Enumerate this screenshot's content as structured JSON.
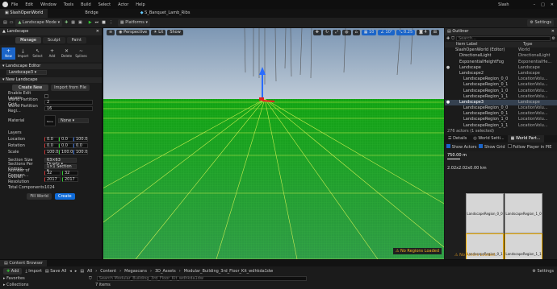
{
  "titlebar": {
    "project": "SlashOpenWorld",
    "menu": [
      "File",
      "Edit",
      "Window",
      "Tools",
      "Build",
      "Select",
      "Actor",
      "Help"
    ],
    "user": "Slash"
  },
  "tabs": [
    "Landscape Mode",
    "Bridge",
    "S_Banquet_Lamb_Ribs"
  ],
  "toolbar": {
    "mode": "Landscape Mode",
    "platforms": "Platforms",
    "settings": "Settings"
  },
  "landscape_panel": {
    "title": "Landscape",
    "subtabs": [
      "Manage",
      "Sculpt",
      "Paint"
    ],
    "tools": [
      {
        "label": "New",
        "icon": "+"
      },
      {
        "label": "Import",
        "icon": "⤓"
      },
      {
        "label": "Select",
        "icon": "↖"
      },
      {
        "label": "Add",
        "icon": "+"
      },
      {
        "label": "Delete",
        "icon": "✕"
      },
      {
        "label": "Splines",
        "icon": "~"
      }
    ],
    "editor_title": "Landscape Editor",
    "editor_value": "Landscape3",
    "new_section": "New Landscape",
    "create_new": "Create New",
    "import_from_file": "Import from File",
    "enable_edit_layers": "Enable Edit Layers",
    "grid_label": "World Partition Grid...",
    "grid_value": "2",
    "region_label": "World Partition Regi...",
    "region_value": "16",
    "material_label": "Material",
    "material_thumb": "None",
    "material_value": "None",
    "layers": "Layers",
    "location_label": "Location",
    "location": [
      "0.0",
      "0.0",
      "100.0"
    ],
    "rotation_label": "Rotation",
    "rotation": [
      "0.0",
      "0.0",
      "0.0"
    ],
    "scale_label": "Scale",
    "scale": [
      "100.0",
      "100.0",
      "100.0"
    ],
    "section_size_label": "Section Size",
    "section_size": "63×63 Quads",
    "sections_label": "Sections Per Compo...",
    "sections": "1×1 Section",
    "components_label": "Number of Compon...",
    "components": [
      "32",
      "32"
    ],
    "resolution_label": "Overall Resolution",
    "resolution": [
      "2017",
      "2017"
    ],
    "total_label": "Total Components",
    "total": "1024",
    "fill_world": "Fill World",
    "create": "Create"
  },
  "viewport": {
    "perspective": "Perspective",
    "lit": "Lit",
    "show": "Show",
    "grid_snap": "10",
    "rot_snap": "10°",
    "scale_snap": "0.25",
    "cam_speed": "4",
    "no_regions": "No Regions Loaded"
  },
  "outliner": {
    "title": "Outliner",
    "search": "Search...",
    "col_label": "Item Label",
    "col_type": "Type",
    "rows": [
      {
        "name": "SlashOpenWorld (Editor)",
        "type": "World",
        "indent": 1,
        "vis": false,
        "sel": false
      },
      {
        "name": "DirectionalLight",
        "type": "DirectionalLight",
        "indent": 2,
        "vis": false,
        "sel": false
      },
      {
        "name": "ExponentialHeightFog",
        "type": "ExponentialHe...",
        "indent": 2,
        "vis": false,
        "sel": false
      },
      {
        "name": "Landscape",
        "type": "Landscape",
        "indent": 2,
        "vis": true,
        "sel": false
      },
      {
        "name": "Landscape2",
        "type": "Landscape",
        "indent": 2,
        "vis": false,
        "sel": false
      },
      {
        "name": "LandscapeRegion_0_0",
        "type": "LocationVolu...",
        "indent": 3,
        "vis": false,
        "sel": false
      },
      {
        "name": "LandscapeRegion_0_1",
        "type": "LocationVolu...",
        "indent": 3,
        "vis": false,
        "sel": false
      },
      {
        "name": "LandscapeRegion_1_0",
        "type": "LocationVolu...",
        "indent": 3,
        "vis": false,
        "sel": false
      },
      {
        "name": "LandscapeRegion_1_1",
        "type": "LocationVolu...",
        "indent": 3,
        "vis": false,
        "sel": false
      },
      {
        "name": "Landscape3",
        "type": "Landscape",
        "indent": 2,
        "vis": true,
        "sel": true
      },
      {
        "name": "LandscapeRegion_0_0",
        "type": "LocationVolu...",
        "indent": 3,
        "vis": false,
        "sel": false
      },
      {
        "name": "LandscapeRegion_0_1",
        "type": "LocationVolu...",
        "indent": 3,
        "vis": false,
        "sel": false
      },
      {
        "name": "LandscapeRegion_1_0",
        "type": "LocationVolu...",
        "indent": 3,
        "vis": false,
        "sel": false
      },
      {
        "name": "LandscapeRegion_1_1",
        "type": "LocationVolu...",
        "indent": 3,
        "vis": false,
        "sel": false
      }
    ],
    "footer": "276 actors (1 selected)"
  },
  "world_partition": {
    "tabs": [
      "Details",
      "World Setti...",
      "World Part..."
    ],
    "show_actors": "Show Actors",
    "show_grid": "Show Grid",
    "follow_player": "Follow Player in PIE",
    "scale": "750.00 m",
    "coords": "2.02x2.02x0.00 km",
    "cells": [
      "LandscapeRegion_0_0",
      "LandscapeRegion_1_0",
      "LandscapeRegion_0_1",
      "LandscapeRegion_1_1"
    ],
    "no_actors": "No Actors Loaded"
  },
  "content_browser": {
    "tab": "Content Browser",
    "add": "Add",
    "import": "Import",
    "save_all": "Save All",
    "path": [
      "All",
      "Content",
      "Megascans",
      "3D_Assets",
      "Modular_Building_3rd_Floor_Kit_wdhkda1dw"
    ],
    "settings": "Settings",
    "favorites": "Favorites",
    "search": "Search Modular_Building_3rd_Floor_Kit_wdhkda1dw",
    "items": "7 items",
    "collections": "Collections"
  }
}
